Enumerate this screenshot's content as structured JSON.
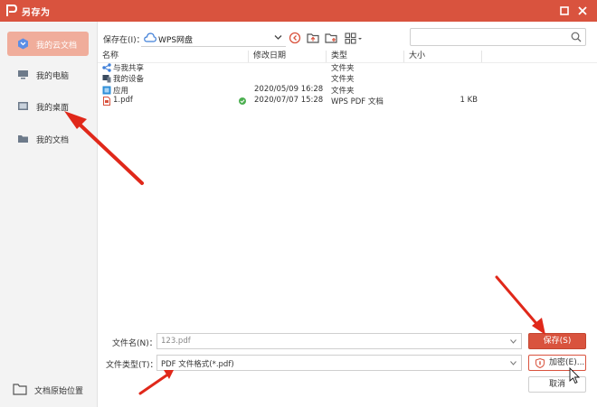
{
  "window": {
    "title": "另存为"
  },
  "sidebar": {
    "items": [
      {
        "label": "我的云文档",
        "icon": "cloud-doc-icon",
        "active": true
      },
      {
        "label": "我的电脑",
        "icon": "computer-icon",
        "active": false
      },
      {
        "label": "我的桌面",
        "icon": "desktop-icon",
        "active": false
      },
      {
        "label": "我的文档",
        "icon": "folder-icon",
        "active": false
      }
    ],
    "bottom_label": "文档原始位置"
  },
  "toolbar": {
    "save_in_label": "保存在(I)：",
    "location": "WPS网盘",
    "search_placeholder": ""
  },
  "filelist": {
    "headers": {
      "name": "名称",
      "modified": "修改日期",
      "type": "类型",
      "size": "大小"
    },
    "rows": [
      {
        "name": "与我共享",
        "modified": "",
        "type": "文件夹",
        "size": "",
        "icon": "share-icon"
      },
      {
        "name": "我的设备",
        "modified": "",
        "type": "文件夹",
        "size": "",
        "icon": "device-icon"
      },
      {
        "name": "应用",
        "modified": "2020/05/09 16:28",
        "type": "文件夹",
        "size": "",
        "icon": "app-icon"
      },
      {
        "name": "1.pdf",
        "modified": "2020/07/07 15:28",
        "type": "WPS PDF 文档",
        "size": "1 KB",
        "icon": "pdf-icon",
        "synced": true
      }
    ]
  },
  "form": {
    "filename_label": "文件名(N)：",
    "filename_value": "123.pdf",
    "filetype_label": "文件类型(T)：",
    "filetype_value": "PDF 文件格式(*.pdf)"
  },
  "buttons": {
    "save": "保存(S)",
    "encrypt": "加密(E)...",
    "cancel": "取消"
  },
  "colors": {
    "accent": "#d9533e",
    "sidebar_active": "#f0ad9b",
    "annotation_arrow": "#e0281a"
  }
}
